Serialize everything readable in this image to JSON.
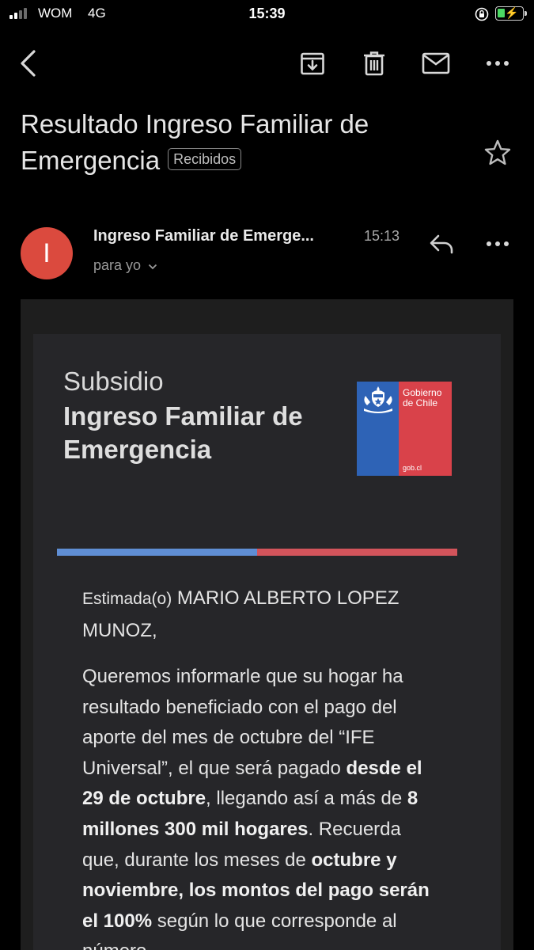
{
  "status_bar": {
    "carrier": "WOM",
    "network": "4G",
    "time": "15:39",
    "battery_level": 0.3,
    "battery_color": "#4cd964"
  },
  "toolbar": {
    "icons": [
      "back-arrow-icon",
      "archive-icon",
      "trash-icon",
      "mail-icon",
      "more-icon"
    ]
  },
  "email": {
    "subject": "Resultado Ingreso Familiar de Emergencia",
    "label": "Recibidos",
    "sender_initial": "I",
    "sender_name": "Ingreso Familiar de Emerge...",
    "time": "15:13",
    "recipient": "para yo",
    "avatar_color": "#db4a3e"
  },
  "body": {
    "hero_sub": "Subsidio",
    "hero_title": "Ingreso Familiar de Emergencia",
    "logo_text": "Gobierno de Chile",
    "logo_url": "gob.cl",
    "greeting_lead": "Estimada(o)",
    "greeting_name": "MARIO ALBERTO LOPEZ MUNOZ,",
    "para": {
      "t1": "Queremos informarle que su hogar ha resultado beneficiado con el pago del aporte del mes de octubre del “IFE Universal”, el que será pagado ",
      "b1": "desde el 29 de octubre",
      "t2": ", llegando así a más de ",
      "b2": "8 millones 300 mil hogares",
      "t3": ". Recuerda que, durante los meses de ",
      "b3": "octubre y noviembre, los montos del pago serán el 100%",
      "t4": " según lo que corresponde al número"
    }
  },
  "colors": {
    "stripe_blue": "#5f8ed4",
    "stripe_red": "#d3545b",
    "logo_blue": "#2e63b6",
    "logo_red": "#d9424a"
  }
}
